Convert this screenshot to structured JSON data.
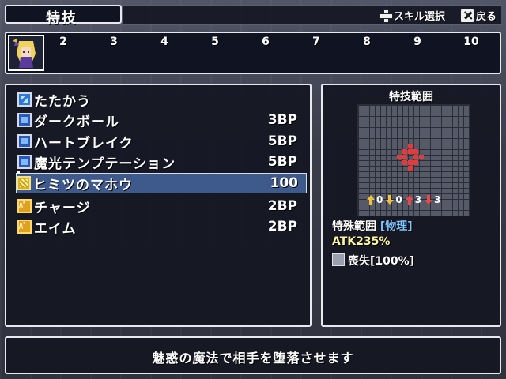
{
  "header": {
    "title": "特技",
    "hints": [
      {
        "icon": "dpad-icon",
        "label": "スキル選択"
      },
      {
        "icon": "x-button-icon",
        "label": "戻る"
      }
    ]
  },
  "party": {
    "slots": [
      "2",
      "3",
      "4",
      "5",
      "6",
      "7",
      "8",
      "9",
      "10"
    ]
  },
  "skills": [
    {
      "icon": "physical-attack-icon",
      "name": "たたかう",
      "cost": ""
    },
    {
      "icon": "magic-skill-icon",
      "name": "ダークボール",
      "cost": "3BP"
    },
    {
      "icon": "magic-skill-icon",
      "name": "ハートブレイク",
      "cost": "5BP"
    },
    {
      "icon": "magic-skill-icon",
      "name": "魔光テンプテーション",
      "cost": "5BP"
    },
    {
      "icon": "special-skill-icon",
      "name": "ヒミツのマホウ",
      "cost": "100",
      "selected": true
    },
    {
      "icon": "buff-skill-icon",
      "name": "チャージ",
      "cost": "2BP"
    },
    {
      "icon": "buff-skill-icon",
      "name": "エイム",
      "cost": "2BP"
    }
  ],
  "range_panel": {
    "title": "特技範囲",
    "modifiers": [
      {
        "dir": "up",
        "value": "0",
        "color": "#f0c040"
      },
      {
        "dir": "down",
        "value": "0",
        "color": "#f0c040"
      },
      {
        "dir": "up",
        "value": "3",
        "color": "#e84848"
      },
      {
        "dir": "down",
        "value": "3",
        "color": "#e84848"
      }
    ],
    "range_type_label": "特殊範囲",
    "range_type_tag": "[物理]",
    "atk": "ATK235%",
    "status_effect": "喪失[100%]"
  },
  "description": "魅惑の魔法で相手を堕落させます",
  "colors": {
    "range_cell": "#e33b3b",
    "selected_row": "#3e5a8c"
  }
}
